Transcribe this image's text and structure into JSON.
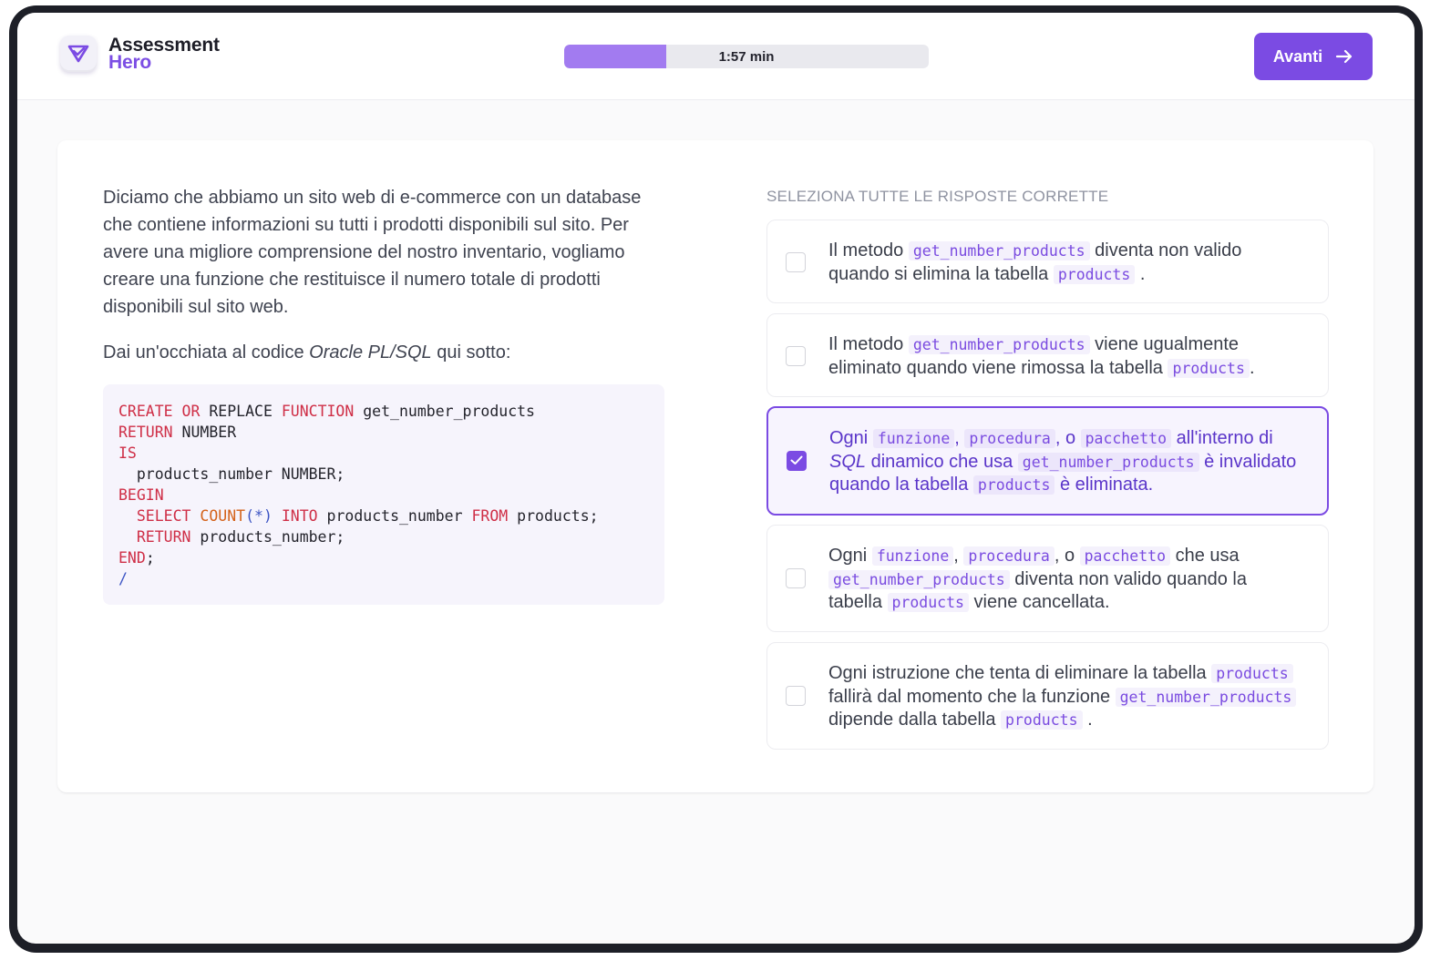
{
  "brand": {
    "line1": "Assessment",
    "line2": "Hero",
    "logo_icon": "heart-check-icon",
    "accent": "#7b4be3"
  },
  "timer": {
    "label": "1:57 min",
    "progress": 0.28
  },
  "next_button": {
    "label": "Avanti",
    "icon": "arrow-right-icon"
  },
  "question": {
    "paragraph1": "Diciamo che abbiamo un sito web di e-commerce con un database che contiene informazioni su tutti i prodotti disponibili sul sito. Per avere una migliore comprensione del nostro inventario, vogliamo creare una funzione che restituisce il numero totale di prodotti disponibili sul sito web.",
    "paragraph2_prefix": "Dai un'occhiata al codice ",
    "paragraph2_em": "Oracle PL/SQL",
    "paragraph2_suffix": " qui sotto:"
  },
  "code_lines": [
    [
      [
        "k",
        "CREATE"
      ],
      [
        "t",
        " "
      ],
      [
        "k",
        "OR"
      ],
      [
        "t",
        " REPLACE "
      ],
      [
        "k",
        "FUNCTION"
      ],
      [
        "t",
        " get_number_products"
      ]
    ],
    [
      [
        "k",
        "RETURN"
      ],
      [
        "t",
        " NUMBER"
      ]
    ],
    [
      [
        "k",
        "IS"
      ]
    ],
    [
      [
        "t",
        "  products_number NUMBER;"
      ]
    ],
    [
      [
        "k",
        "BEGIN"
      ]
    ],
    [
      [
        "t",
        "  "
      ],
      [
        "k",
        "SELECT"
      ],
      [
        "t",
        " "
      ],
      [
        "f",
        "COUNT"
      ],
      [
        "o",
        "(*)"
      ],
      [
        "t",
        " "
      ],
      [
        "k",
        "INTO"
      ],
      [
        "t",
        " products_number "
      ],
      [
        "k",
        "FROM"
      ],
      [
        "t",
        " products;"
      ]
    ],
    [
      [
        "t",
        "  "
      ],
      [
        "k",
        "RETURN"
      ],
      [
        "t",
        " products_number;"
      ]
    ],
    [
      [
        "k",
        "END"
      ],
      [
        "t",
        ";"
      ]
    ],
    [
      [
        "o",
        "/"
      ]
    ]
  ],
  "instruction": "SELEZIONA TUTTE LE RISPOSTE CORRETTE",
  "options": [
    {
      "checked": false,
      "parts": [
        [
          "t",
          "Il metodo "
        ],
        [
          "c",
          "get_number_products"
        ],
        [
          "t",
          " diventa non valido quando si elimina la tabella "
        ],
        [
          "c",
          "products"
        ],
        [
          "t",
          " ."
        ]
      ]
    },
    {
      "checked": false,
      "parts": [
        [
          "t",
          "Il metodo "
        ],
        [
          "c",
          "get_number_products"
        ],
        [
          "t",
          " viene ugualmente eliminato quando viene rimossa la tabella "
        ],
        [
          "c",
          "products"
        ],
        [
          "t",
          "."
        ]
      ]
    },
    {
      "checked": true,
      "parts": [
        [
          "t",
          "Ogni "
        ],
        [
          "c",
          "funzione"
        ],
        [
          "t",
          ", "
        ],
        [
          "c",
          "procedura"
        ],
        [
          "t",
          ", o "
        ],
        [
          "c",
          "pacchetto"
        ],
        [
          "t",
          " all'interno di "
        ],
        [
          "e",
          "SQL"
        ],
        [
          "t",
          " dinamico che usa "
        ],
        [
          "c",
          "get_number_products"
        ],
        [
          "t",
          " è invalidato quando la tabella "
        ],
        [
          "c",
          "products"
        ],
        [
          "t",
          " è eliminata."
        ]
      ]
    },
    {
      "checked": false,
      "parts": [
        [
          "t",
          "Ogni "
        ],
        [
          "c",
          "funzione"
        ],
        [
          "t",
          ", "
        ],
        [
          "c",
          "procedura"
        ],
        [
          "t",
          ", o "
        ],
        [
          "c",
          "pacchetto"
        ],
        [
          "t",
          " che usa "
        ],
        [
          "c",
          "get_number_products"
        ],
        [
          "t",
          " diventa non valido quando la tabella "
        ],
        [
          "c",
          "products"
        ],
        [
          "t",
          " viene cancellata."
        ]
      ]
    },
    {
      "checked": false,
      "parts": [
        [
          "t",
          "Ogni istruzione che tenta di eliminare la tabella "
        ],
        [
          "c",
          "products"
        ],
        [
          "t",
          " fallirà dal momento che la funzione "
        ],
        [
          "c",
          "get_number_products"
        ],
        [
          "t",
          " dipende dalla tabella "
        ],
        [
          "c",
          "products"
        ],
        [
          "t",
          " ."
        ]
      ]
    }
  ]
}
